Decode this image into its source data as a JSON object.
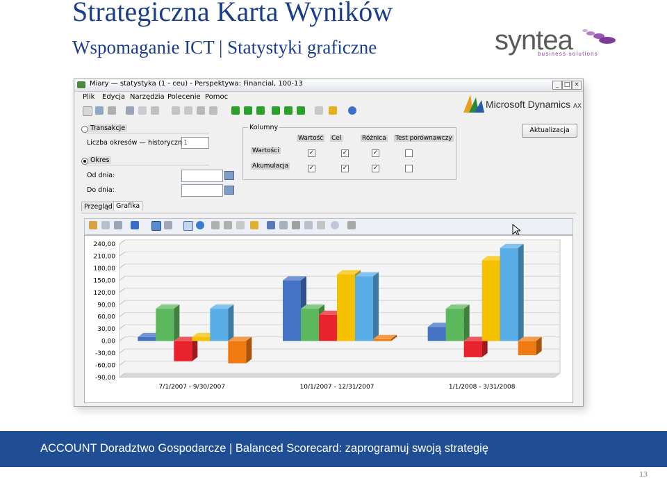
{
  "slide": {
    "title": "Strategiczna Karta Wyników",
    "subtitle": "Wspomaganie ICT | Statystyki graficzne",
    "logo_name": "syntea",
    "logo_tagline": "business solutions",
    "footer": "ACCOUNT Doradztwo Gospodarcze | Balanced Scorecard: zaprogramuj swoją strategię",
    "page_number": "13"
  },
  "window": {
    "title": "Miary — statystyka (1 - ceu) - Perspektywa: Financial, 100-13",
    "controls": [
      "_",
      "□",
      "×"
    ],
    "menu": [
      "Plik",
      "Edycja",
      "Narzędzia",
      "Polecenie",
      "Pomoc"
    ],
    "brand": "Microsoft Dynamics",
    "brand_suffix": "AX"
  },
  "form": {
    "transakcje_label": "Transakcje",
    "periods_label": "Liczba okresów — historycznie:",
    "periods_value": "1",
    "okres_label": "Okres",
    "od_label": "Od dnia:",
    "do_label": "Do dnia:",
    "od_value": "",
    "do_value": "",
    "selected_option": "Okres",
    "refresh_button": "Aktualizacja"
  },
  "columns_group": {
    "title": "Kolumny",
    "headers": [
      "Wartość",
      "Cel",
      "Różnica",
      "Test porównawczy"
    ],
    "rows": [
      {
        "label": "Wartości",
        "checks": [
          true,
          true,
          true,
          false
        ]
      },
      {
        "label": "Akumulacja",
        "checks": [
          true,
          true,
          true,
          false
        ]
      }
    ]
  },
  "tabs": [
    "Przegląd",
    "Grafika"
  ],
  "active_tab": "Grafika",
  "chart_data": {
    "type": "bar",
    "categories": [
      "7/1/2007 - 9/30/2007",
      "10/1/2007 - 12/31/2007",
      "1/1/2008 - 3/31/2008"
    ],
    "ylim": [
      -90,
      240
    ],
    "yticks": [
      "240,00",
      "210,00",
      "180,00",
      "150,00",
      "120,00",
      "90,00",
      "60,00",
      "30,00",
      "0,00",
      "-30,00",
      "-60,00",
      "-90,00"
    ],
    "grid": true,
    "legend": "none",
    "series": [
      {
        "color": "#4472c4",
        "values": [
          10,
          150,
          35
        ]
      },
      {
        "color": "#5cb85c",
        "values": [
          80,
          80,
          80
        ]
      },
      {
        "color": "#e8232e",
        "values": [
          -50,
          65,
          -40
        ]
      },
      {
        "color": "#f5c000",
        "values": [
          10,
          165,
          200
        ]
      },
      {
        "color": "#5aaee8",
        "values": [
          80,
          160,
          230
        ]
      },
      {
        "color": "#f07a10",
        "values": [
          -55,
          5,
          -35
        ]
      }
    ]
  }
}
